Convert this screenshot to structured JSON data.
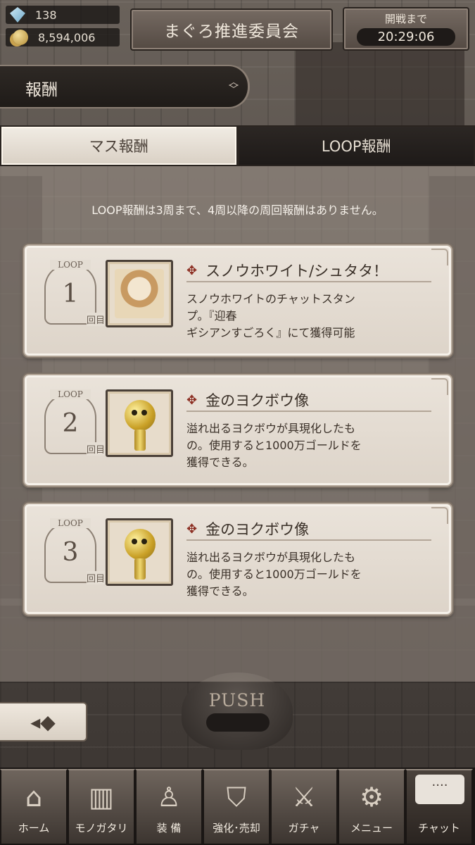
{
  "header": {
    "gems": "138",
    "gold": "8,594,006",
    "title": "まぐろ推進委員会",
    "timer_label": "開戦まで",
    "timer_value": "20:29:06"
  },
  "section": {
    "title": "報酬"
  },
  "tabs": [
    {
      "label": "マス報酬",
      "active": true
    },
    {
      "label": "LOOP報酬",
      "active": false
    }
  ],
  "notice": "LOOP報酬は3周まで、4周以降の周回報酬はありません。",
  "rewards": [
    {
      "loop_label": "LOOP",
      "loop_number": "1",
      "loop_suffix": "回目",
      "name": "スノウホワイト/シュタタ！",
      "desc_lines": [
        "スノウホワイトのチャットスタン",
        "プ。『迎春",
        "ギシアンすごろく』にて獲得可能"
      ]
    },
    {
      "loop_label": "LOOP",
      "loop_number": "2",
      "loop_suffix": "回目",
      "name": "金のヨクボウ像",
      "desc_lines": [
        "溢れ出るヨクボウが具現化したも",
        "の。使用すると1000万ゴールドを",
        "獲得できる。"
      ]
    },
    {
      "loop_label": "LOOP",
      "loop_number": "3",
      "loop_suffix": "回目",
      "name": "金のヨクボウ像",
      "desc_lines": [
        "溢れ出るヨクボウが具現化したも",
        "の。使用すると1000万ゴールドを",
        "獲得できる。"
      ]
    }
  ],
  "push_label": "PUSH",
  "nav": [
    {
      "label": "ホーム",
      "icon": "castle-icon"
    },
    {
      "label": "モノガタリ",
      "icon": "book-icon"
    },
    {
      "label": "装 備",
      "icon": "puppet-icon"
    },
    {
      "label": "強化･売却",
      "icon": "helmet-icon"
    },
    {
      "label": "ガチャ",
      "icon": "swords-icon"
    },
    {
      "label": "メニュー",
      "icon": "gears-icon"
    },
    {
      "label": "チャット",
      "icon": "chat-bubble-icon",
      "bubble": "····"
    }
  ]
}
